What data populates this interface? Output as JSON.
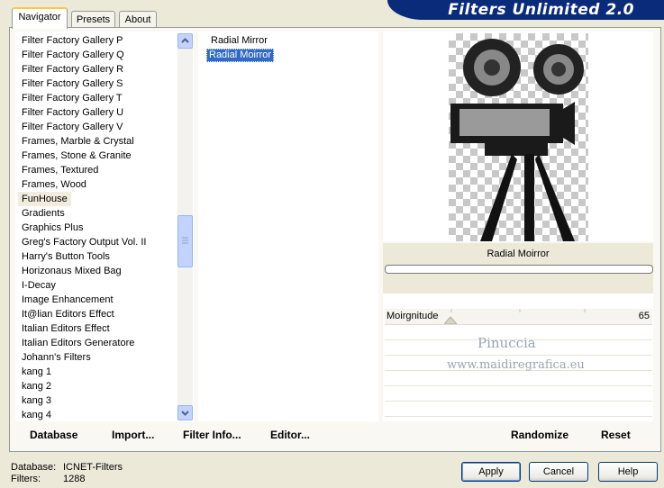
{
  "banner": {
    "title": "Filters Unlimited 2.0"
  },
  "tabs": [
    "Navigator",
    "Presets",
    "About"
  ],
  "categories": [
    "Filter Factory Gallery P",
    "Filter Factory Gallery Q",
    "Filter Factory Gallery R",
    "Filter Factory Gallery S",
    "Filter Factory Gallery T",
    "Filter Factory Gallery U",
    "Filter Factory Gallery V",
    "Frames, Marble & Crystal",
    "Frames, Stone & Granite",
    "Frames, Textured",
    "Frames, Wood",
    "FunHouse",
    "Gradients",
    "Graphics Plus",
    "Greg's Factory Output Vol. II",
    "Harry's Button Tools",
    "Horizonaus Mixed Bag",
    "I-Decay",
    "Image Enhancement",
    "It@lian Editors Effect",
    "Italian Editors Effect",
    "Italian Editors Generatore",
    "Johann's Filters",
    "kang 1",
    "kang 2",
    "kang 3",
    "kang 4"
  ],
  "selected_category": "FunHouse",
  "filters": [
    "Radial Mirror",
    "Radial Moirror"
  ],
  "selected_filter": "Radial Moirror",
  "preview": {
    "filter_name": "Radial Moirror",
    "progress": 0
  },
  "params": [
    {
      "name": "Moirgnitude",
      "value": "65"
    }
  ],
  "watermark": {
    "line1": "Pinuccia",
    "line2": "www.maidiregrafica.eu"
  },
  "bottom_buttons": {
    "database": "Database",
    "import": "Import...",
    "filter_info": "Filter Info...",
    "editor": "Editor...",
    "randomize": "Randomize",
    "reset": "Reset"
  },
  "status": {
    "database_label": "Database:",
    "database_value": "ICNET-Filters",
    "filters_label": "Filters:",
    "filters_value": "1288"
  },
  "dialog_buttons": {
    "apply": "Apply",
    "cancel": "Cancel",
    "help": "Help"
  }
}
